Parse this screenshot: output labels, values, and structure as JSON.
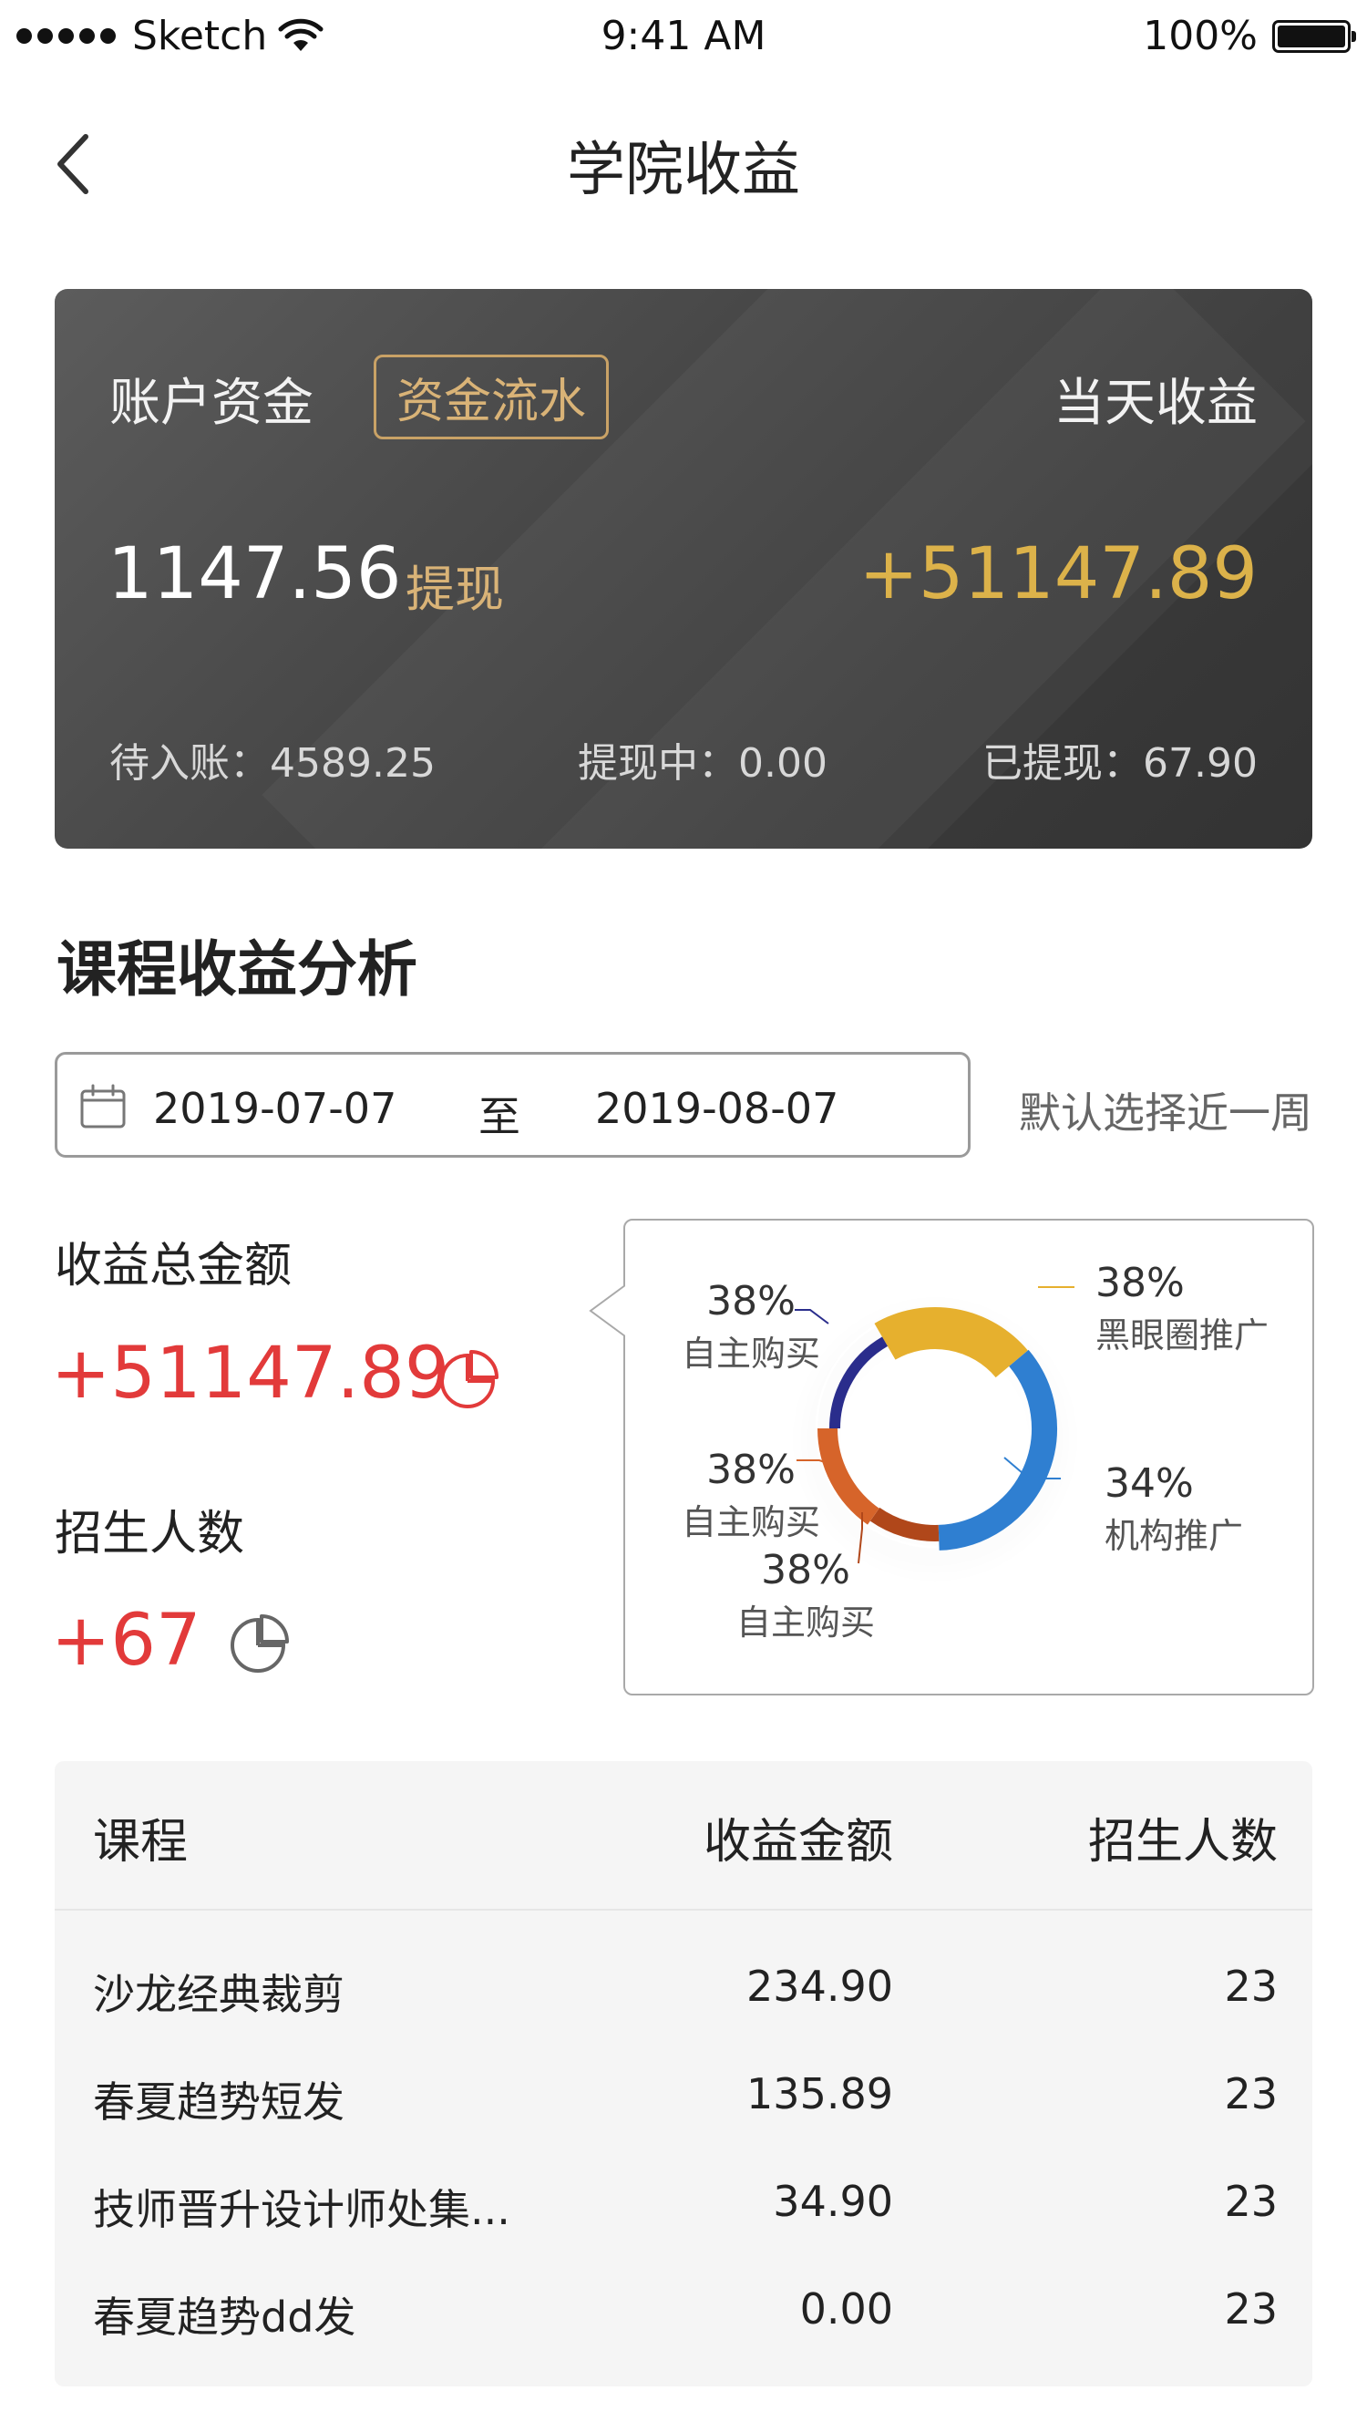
{
  "status_bar": {
    "carrier": "Sketch",
    "time": "9:41 AM",
    "battery": "100%"
  },
  "nav": {
    "title": "学院收益"
  },
  "account": {
    "label": "账户资金",
    "flow_button": "资金流水",
    "today_label": "当天收益",
    "balance": "1147.56",
    "withdraw_button": "提现",
    "today_income": "+51147.89",
    "pending": "待入账：4589.25",
    "withdrawing": "提现中：0.00",
    "withdrawn": "已提现：67.90"
  },
  "analysis": {
    "title": "课程收益分析",
    "date_start": "2019-07-07",
    "date_sep": "至",
    "date_end": "2019-08-07",
    "default_hint": "默认选择近一周",
    "total_label": "收益总金额",
    "total_value": "+51147.89",
    "enroll_label": "招生人数",
    "enroll_value": "+67"
  },
  "chart_data": {
    "type": "pie",
    "segments": [
      {
        "label": "黑眼圈推广",
        "value_label": "38%",
        "color": "#e6b02e"
      },
      {
        "label": "机构推广",
        "value_label": "34%",
        "color": "#2f7fd1"
      },
      {
        "label": "自主购买",
        "value_label": "38%",
        "color": "#b0471a"
      },
      {
        "label": "自主购买",
        "value_label": "38%",
        "color": "#d6642a"
      },
      {
        "label": "自主购买",
        "value_label": "38%",
        "color": "#2a2d8c"
      }
    ]
  },
  "table": {
    "headers": [
      "课程",
      "收益金额",
      "招生人数"
    ],
    "rows": [
      {
        "course": "沙龙经典裁剪",
        "amount": "234.90",
        "count": "23"
      },
      {
        "course": "春夏趋势短发",
        "amount": "135.89",
        "count": "23"
      },
      {
        "course": "技师晋升设计师处集...",
        "amount": "34.90",
        "count": "23"
      },
      {
        "course": "春夏趋势dd发",
        "amount": "0.00",
        "count": "23"
      }
    ]
  },
  "colors": {
    "accent_red": "#e23a3a",
    "gold": "#dcb24a",
    "card_dark": "#3a3a3a"
  }
}
